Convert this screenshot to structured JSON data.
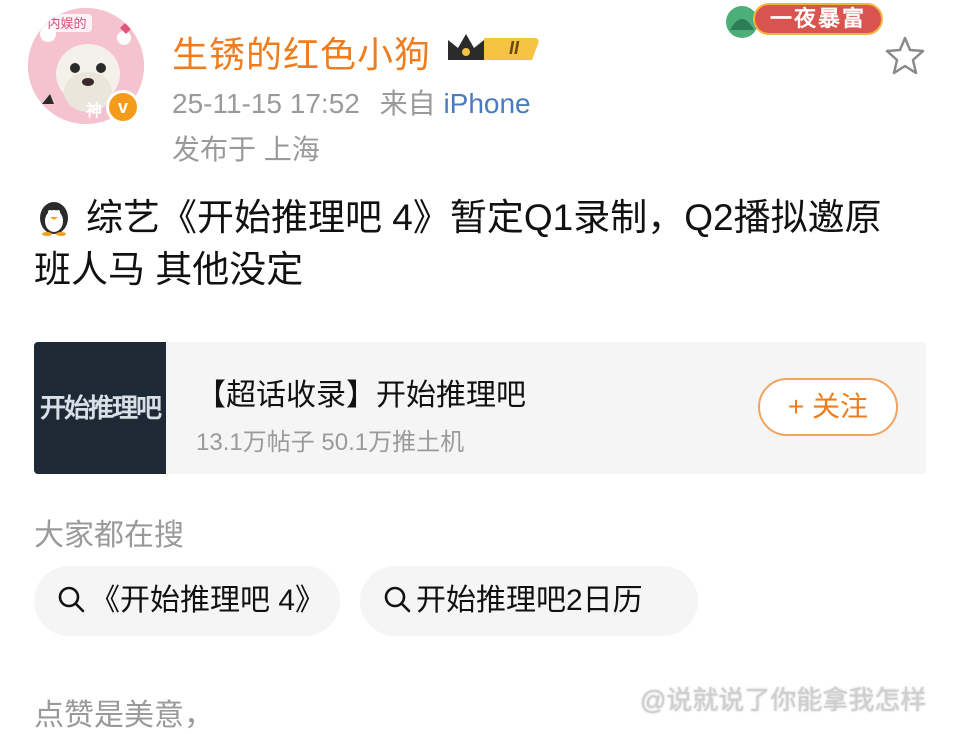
{
  "user": {
    "name": "生锈的红色小狗",
    "vip_level": "II",
    "avatar_icon": "ferret-avatar-icon",
    "verified_icon": "verified-v-icon",
    "verified_mark": "v"
  },
  "post": {
    "timestamp": "25-11-15 17:52",
    "source_prefix": "来自",
    "source": "iPhone",
    "location": "发布于 上海",
    "text": "综艺《开始推理吧 4》暂定Q1录制，Q2播拟邀原班人马 其他没定"
  },
  "promo": {
    "label": "一夜暴富"
  },
  "card": {
    "thumb_text": "开始推理吧",
    "title": "【超话收录】开始推理吧",
    "stats": "13.1万帖子 50.1万推土机",
    "follow_label": "+ 关注"
  },
  "search": {
    "heading": "大家都在搜",
    "chips": [
      "《开始推理吧 4》",
      "开始推理吧2日历"
    ]
  },
  "footer": {
    "text": "点赞是美意，",
    "watermark": "@说就说了你能拿我怎样"
  },
  "colors": {
    "username": "#f07c1c",
    "source_link": "#4a7bbf",
    "muted": "#9a9a9a",
    "card_bg": "#f5f5f5",
    "follow_border": "#f5a25e"
  }
}
